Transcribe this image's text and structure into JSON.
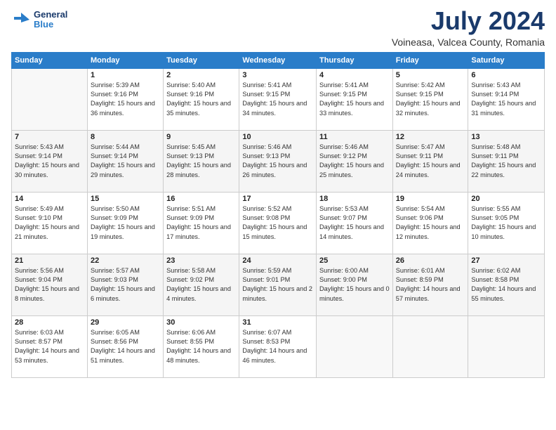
{
  "header": {
    "logo_general": "General",
    "logo_blue": "Blue",
    "month": "July 2024",
    "location": "Voineasa, Valcea County, Romania"
  },
  "weekdays": [
    "Sunday",
    "Monday",
    "Tuesday",
    "Wednesday",
    "Thursday",
    "Friday",
    "Saturday"
  ],
  "weeks": [
    [
      {
        "day": "",
        "empty": true
      },
      {
        "day": "1",
        "sunrise": "5:39 AM",
        "sunset": "9:16 PM",
        "daylight": "15 hours and 36 minutes."
      },
      {
        "day": "2",
        "sunrise": "5:40 AM",
        "sunset": "9:16 PM",
        "daylight": "15 hours and 35 minutes."
      },
      {
        "day": "3",
        "sunrise": "5:41 AM",
        "sunset": "9:15 PM",
        "daylight": "15 hours and 34 minutes."
      },
      {
        "day": "4",
        "sunrise": "5:41 AM",
        "sunset": "9:15 PM",
        "daylight": "15 hours and 33 minutes."
      },
      {
        "day": "5",
        "sunrise": "5:42 AM",
        "sunset": "9:15 PM",
        "daylight": "15 hours and 32 minutes."
      },
      {
        "day": "6",
        "sunrise": "5:43 AM",
        "sunset": "9:14 PM",
        "daylight": "15 hours and 31 minutes."
      }
    ],
    [
      {
        "day": "7",
        "sunrise": "5:43 AM",
        "sunset": "9:14 PM",
        "daylight": "15 hours and 30 minutes."
      },
      {
        "day": "8",
        "sunrise": "5:44 AM",
        "sunset": "9:14 PM",
        "daylight": "15 hours and 29 minutes."
      },
      {
        "day": "9",
        "sunrise": "5:45 AM",
        "sunset": "9:13 PM",
        "daylight": "15 hours and 28 minutes."
      },
      {
        "day": "10",
        "sunrise": "5:46 AM",
        "sunset": "9:13 PM",
        "daylight": "15 hours and 26 minutes."
      },
      {
        "day": "11",
        "sunrise": "5:46 AM",
        "sunset": "9:12 PM",
        "daylight": "15 hours and 25 minutes."
      },
      {
        "day": "12",
        "sunrise": "5:47 AM",
        "sunset": "9:11 PM",
        "daylight": "15 hours and 24 minutes."
      },
      {
        "day": "13",
        "sunrise": "5:48 AM",
        "sunset": "9:11 PM",
        "daylight": "15 hours and 22 minutes."
      }
    ],
    [
      {
        "day": "14",
        "sunrise": "5:49 AM",
        "sunset": "9:10 PM",
        "daylight": "15 hours and 21 minutes."
      },
      {
        "day": "15",
        "sunrise": "5:50 AM",
        "sunset": "9:09 PM",
        "daylight": "15 hours and 19 minutes."
      },
      {
        "day": "16",
        "sunrise": "5:51 AM",
        "sunset": "9:09 PM",
        "daylight": "15 hours and 17 minutes."
      },
      {
        "day": "17",
        "sunrise": "5:52 AM",
        "sunset": "9:08 PM",
        "daylight": "15 hours and 15 minutes."
      },
      {
        "day": "18",
        "sunrise": "5:53 AM",
        "sunset": "9:07 PM",
        "daylight": "15 hours and 14 minutes."
      },
      {
        "day": "19",
        "sunrise": "5:54 AM",
        "sunset": "9:06 PM",
        "daylight": "15 hours and 12 minutes."
      },
      {
        "day": "20",
        "sunrise": "5:55 AM",
        "sunset": "9:05 PM",
        "daylight": "15 hours and 10 minutes."
      }
    ],
    [
      {
        "day": "21",
        "sunrise": "5:56 AM",
        "sunset": "9:04 PM",
        "daylight": "15 hours and 8 minutes."
      },
      {
        "day": "22",
        "sunrise": "5:57 AM",
        "sunset": "9:03 PM",
        "daylight": "15 hours and 6 minutes."
      },
      {
        "day": "23",
        "sunrise": "5:58 AM",
        "sunset": "9:02 PM",
        "daylight": "15 hours and 4 minutes."
      },
      {
        "day": "24",
        "sunrise": "5:59 AM",
        "sunset": "9:01 PM",
        "daylight": "15 hours and 2 minutes."
      },
      {
        "day": "25",
        "sunrise": "6:00 AM",
        "sunset": "9:00 PM",
        "daylight": "15 hours and 0 minutes."
      },
      {
        "day": "26",
        "sunrise": "6:01 AM",
        "sunset": "8:59 PM",
        "daylight": "14 hours and 57 minutes."
      },
      {
        "day": "27",
        "sunrise": "6:02 AM",
        "sunset": "8:58 PM",
        "daylight": "14 hours and 55 minutes."
      }
    ],
    [
      {
        "day": "28",
        "sunrise": "6:03 AM",
        "sunset": "8:57 PM",
        "daylight": "14 hours and 53 minutes."
      },
      {
        "day": "29",
        "sunrise": "6:05 AM",
        "sunset": "8:56 PM",
        "daylight": "14 hours and 51 minutes."
      },
      {
        "day": "30",
        "sunrise": "6:06 AM",
        "sunset": "8:55 PM",
        "daylight": "14 hours and 48 minutes."
      },
      {
        "day": "31",
        "sunrise": "6:07 AM",
        "sunset": "8:53 PM",
        "daylight": "14 hours and 46 minutes."
      },
      {
        "day": "",
        "empty": true
      },
      {
        "day": "",
        "empty": true
      },
      {
        "day": "",
        "empty": true
      }
    ]
  ]
}
